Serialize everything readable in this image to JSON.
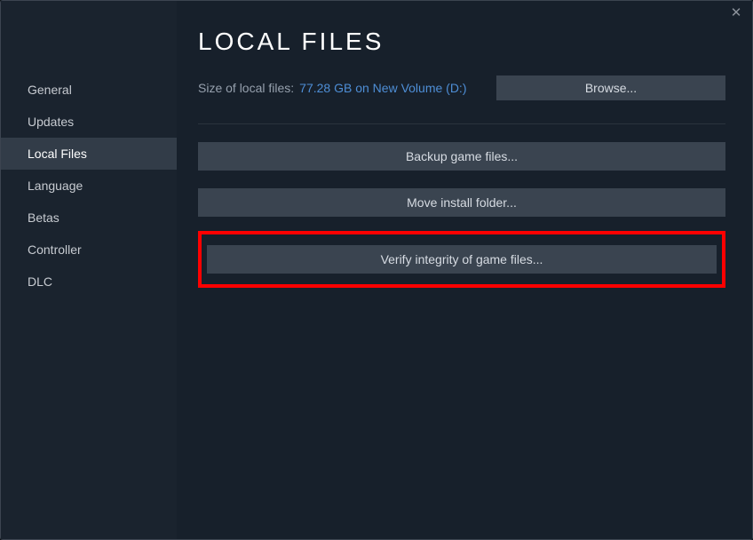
{
  "close_glyph": "✕",
  "sidebar": {
    "items": [
      {
        "label": "General",
        "active": false
      },
      {
        "label": "Updates",
        "active": false
      },
      {
        "label": "Local Files",
        "active": true
      },
      {
        "label": "Language",
        "active": false
      },
      {
        "label": "Betas",
        "active": false
      },
      {
        "label": "Controller",
        "active": false
      },
      {
        "label": "DLC",
        "active": false
      }
    ]
  },
  "main": {
    "title": "LOCAL FILES",
    "size_label": "Size of local files:",
    "size_link": "77.28 GB on New Volume (D:)",
    "browse_label": "Browse...",
    "backup_label": "Backup game files...",
    "move_label": "Move install folder...",
    "verify_label": "Verify integrity of game files..."
  }
}
